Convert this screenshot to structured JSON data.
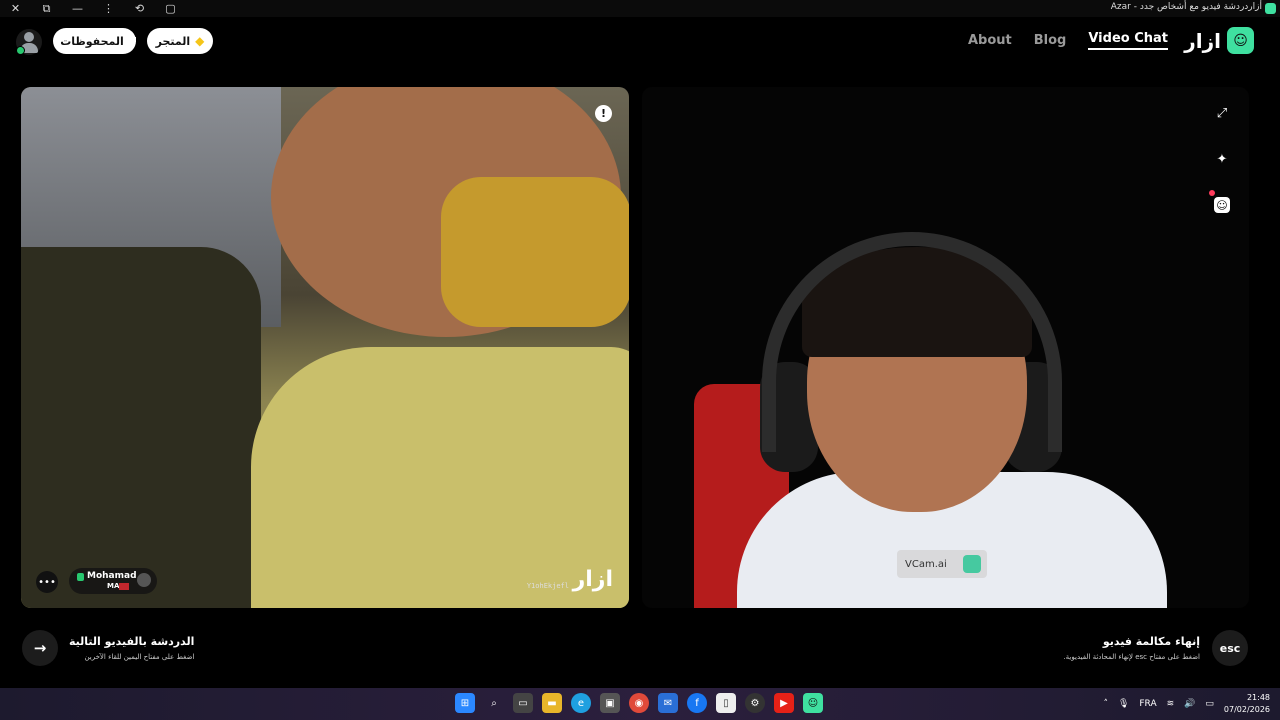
{
  "window": {
    "title": "أزاردردشة فيديو مع أشخاص جدد - Azar",
    "controls": [
      "✕",
      "⧉",
      "—",
      "⋮",
      "⟲",
      "▢"
    ]
  },
  "header": {
    "saved_label": "المحفوظات",
    "store_label": "المتجر",
    "nav": [
      "About",
      "Blog",
      "Video Chat"
    ],
    "brand": "ازار"
  },
  "left_video": {
    "peer_name": "Mohamad",
    "peer_country": "MA",
    "user_id": "Y1ohEkjefl",
    "watermark": "ازار"
  },
  "right_video": {
    "vcam_label": "VCam.ai"
  },
  "footer": {
    "next_title": "الدردشة بالفيديو التالية",
    "next_sub": "اضغط على مفتاح اليمين للقاء الآخرين",
    "end_title": "إنهاء مكالمة فيديو",
    "end_sub": "اضغط على مفتاح esc لإنهاء المحادثة الفيديوية.",
    "esc_label": "esc",
    "next_arrow": "→"
  },
  "taskbar": {
    "language": "FRA",
    "time": "21:48",
    "date": "07/02/2026"
  },
  "colors": {
    "accent": "#3fe0a0",
    "online": "#28c76f"
  }
}
